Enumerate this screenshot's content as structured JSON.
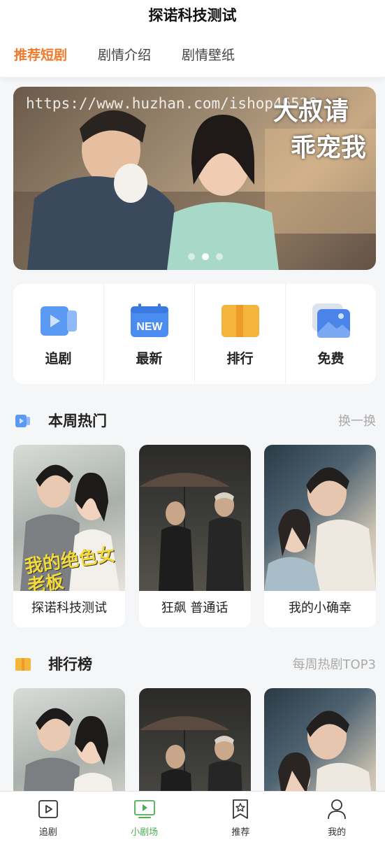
{
  "header": {
    "title": "探诺科技测试",
    "tabs": [
      {
        "label": "推荐短剧",
        "active": true
      },
      {
        "label": "剧情介绍",
        "active": false
      },
      {
        "label": "剧情壁纸",
        "active": false
      }
    ]
  },
  "banner": {
    "watermark": "https://www.huzhan.com/ishop46520",
    "logo_text": "大叔请乖宠我",
    "slide_count": 3,
    "active_slide": 2
  },
  "quick_menu": [
    {
      "label": "追剧",
      "icon": "video-play-icon"
    },
    {
      "label": "最新",
      "icon": "calendar-new-icon",
      "badge": "NEW"
    },
    {
      "label": "排行",
      "icon": "book-rank-icon"
    },
    {
      "label": "免费",
      "icon": "image-gallery-icon"
    }
  ],
  "hot_section": {
    "title": "本周热门",
    "more": "换一换",
    "items": [
      {
        "title": "探诺科技测试",
        "poster_text": "我的绝色女老板"
      },
      {
        "title": "狂飙 普通话"
      },
      {
        "title": "我的小确幸"
      }
    ]
  },
  "rank_section": {
    "title": "排行榜",
    "more": "每周热剧TOP3"
  },
  "tabbar": [
    {
      "label": "追剧",
      "icon": "play-square-icon",
      "active": false
    },
    {
      "label": "小剧场",
      "icon": "tv-play-icon",
      "active": true
    },
    {
      "label": "推荐",
      "icon": "bookmark-star-icon",
      "active": false
    },
    {
      "label": "我的",
      "icon": "user-icon",
      "active": false
    }
  ],
  "colors": {
    "accent": "#f07a2c",
    "tab_active": "#4caf50",
    "blue_icon": "#4a8cf0",
    "yellow_icon": "#f5b43a"
  }
}
